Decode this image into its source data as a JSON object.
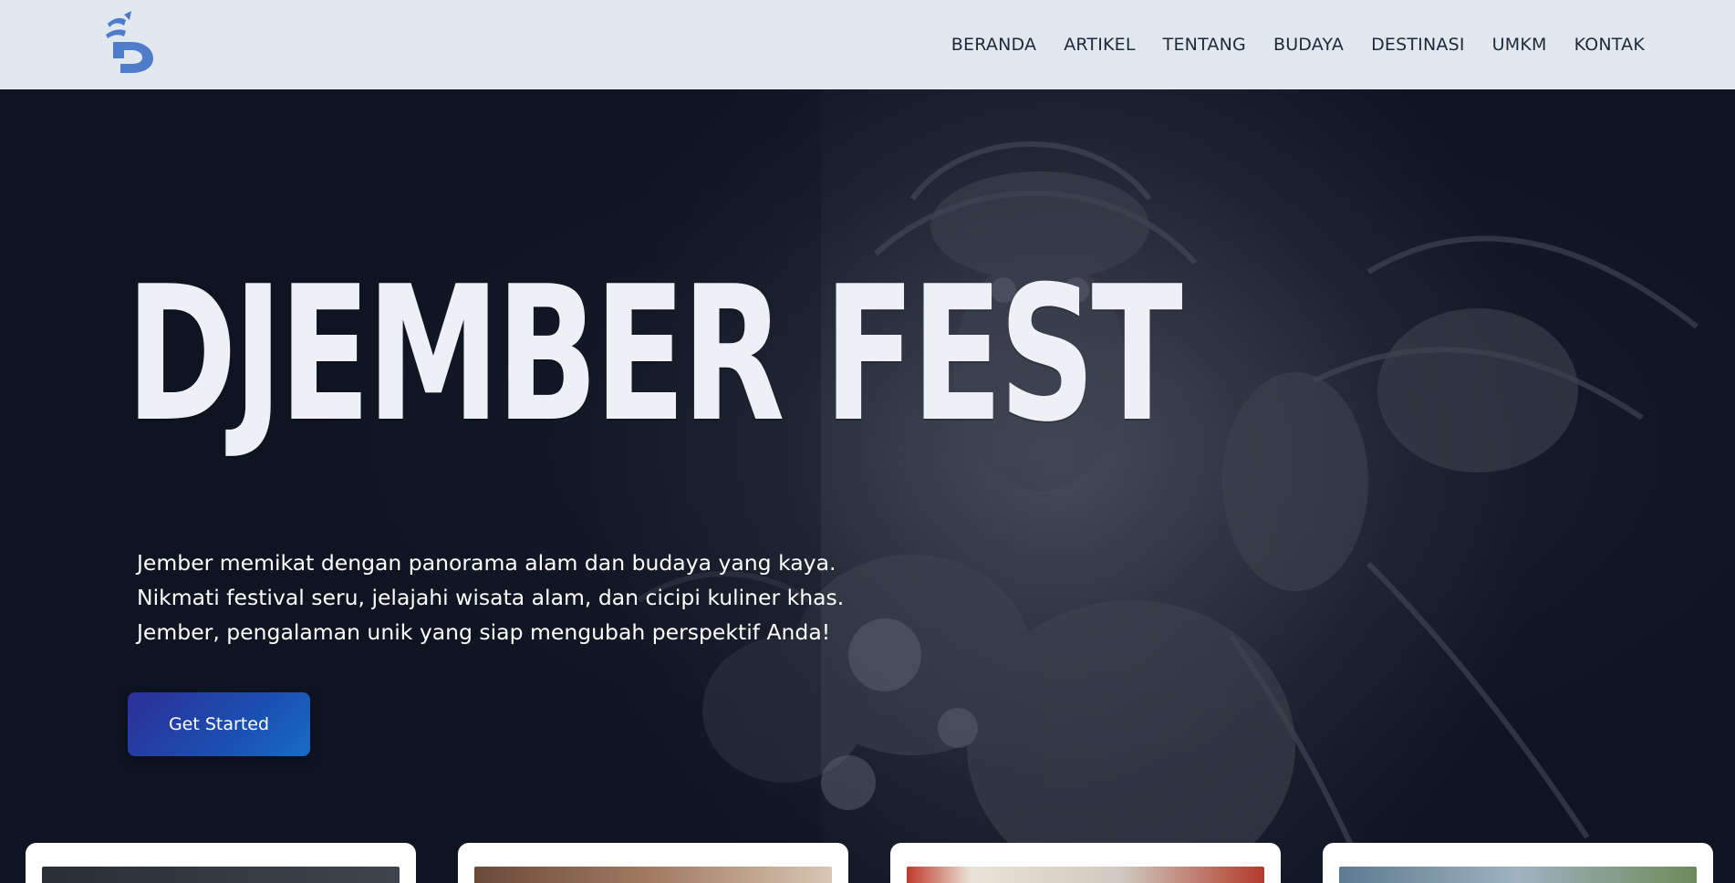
{
  "brand": {
    "logo_icon": "djember-logo-icon",
    "accent": "#4f7ccb"
  },
  "nav": {
    "items": [
      {
        "label": "BERANDA"
      },
      {
        "label": "ARTIKEL"
      },
      {
        "label": "TENTANG"
      },
      {
        "label": "BUDAYA"
      },
      {
        "label": "DESTINASI"
      },
      {
        "label": "UMKM"
      },
      {
        "label": "KONTAK"
      }
    ]
  },
  "hero": {
    "title": "DJEMBER FEST",
    "lines": [
      "Jember memikat dengan panorama alam dan budaya yang kaya.",
      "Nikmati festival seru, jelajahi wisata alam, dan cicipi kuliner khas.",
      "Jember, pengalaman unik yang siap mengubah perspektif Anda!"
    ],
    "cta_label": "Get Started",
    "background_image": "costumed-performer-photo"
  },
  "cards": [
    {
      "image": "card-photo-1"
    },
    {
      "image": "card-photo-2"
    },
    {
      "image": "card-photo-3"
    },
    {
      "image": "card-photo-4"
    }
  ]
}
